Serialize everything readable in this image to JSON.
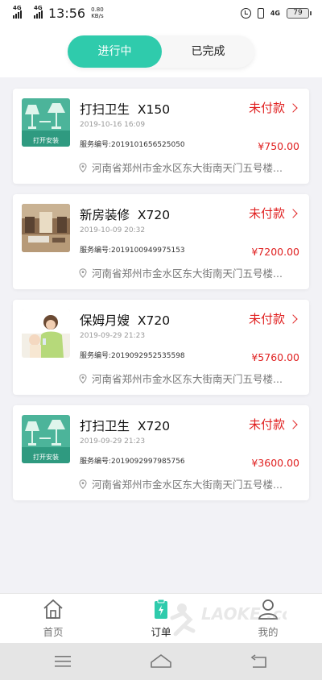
{
  "status_bar": {
    "signal_1": "4G",
    "signal_2": "4G",
    "time": "13:56",
    "speed_value": "0.80",
    "speed_unit": "KB/s",
    "net_type": "4G",
    "battery": "79"
  },
  "tabs": [
    {
      "label": "进行中",
      "active": true
    },
    {
      "label": "已完成",
      "active": false
    }
  ],
  "orders": [
    {
      "name": "打扫卫生",
      "qty": "X150",
      "status": "未付款",
      "time": "2019-10-16 16:09",
      "service_no": "服务编号:2019101656525050",
      "price": "¥750.00",
      "address": "河南省郑州市金水区东大街南天门五号楼...",
      "thumb_text": "打开安装",
      "thumb_icon": "lamp-thumbnail"
    },
    {
      "name": "新房装修",
      "qty": "X720",
      "status": "未付款",
      "time": "2019-10-09 20:32",
      "service_no": "服务编号:2019100949975153",
      "price": "¥7200.00",
      "address": "河南省郑州市金水区东大街南天门五号楼...",
      "thumb_icon": "living-room-thumbnail"
    },
    {
      "name": "保姆月嫂",
      "qty": "X720",
      "status": "未付款",
      "time": "2019-09-29 21:23",
      "service_no": "服务编号:2019092952535598",
      "price": "¥5760.00",
      "address": "河南省郑州市金水区东大街南天门五号楼...",
      "thumb_icon": "nanny-thumbnail"
    },
    {
      "name": "打扫卫生",
      "qty": "X720",
      "status": "未付款",
      "time": "2019-09-29 21:23",
      "service_no": "服务编号:2019092997985756",
      "price": "¥3600.00",
      "address": "河南省郑州市金水区东大街南天门五号楼...",
      "thumb_text": "打开安装",
      "thumb_icon": "lamp-thumbnail"
    }
  ],
  "bottom_nav": [
    {
      "label": "首页",
      "icon": "home-icon",
      "active": false
    },
    {
      "label": "订单",
      "icon": "order-icon",
      "active": true
    },
    {
      "label": "我的",
      "icon": "profile-icon",
      "active": false
    }
  ],
  "watermark": "LAOKE .com",
  "colors": {
    "accent": "#2fcbac",
    "unpaid": "#e02020",
    "background": "#f2f2f6"
  }
}
